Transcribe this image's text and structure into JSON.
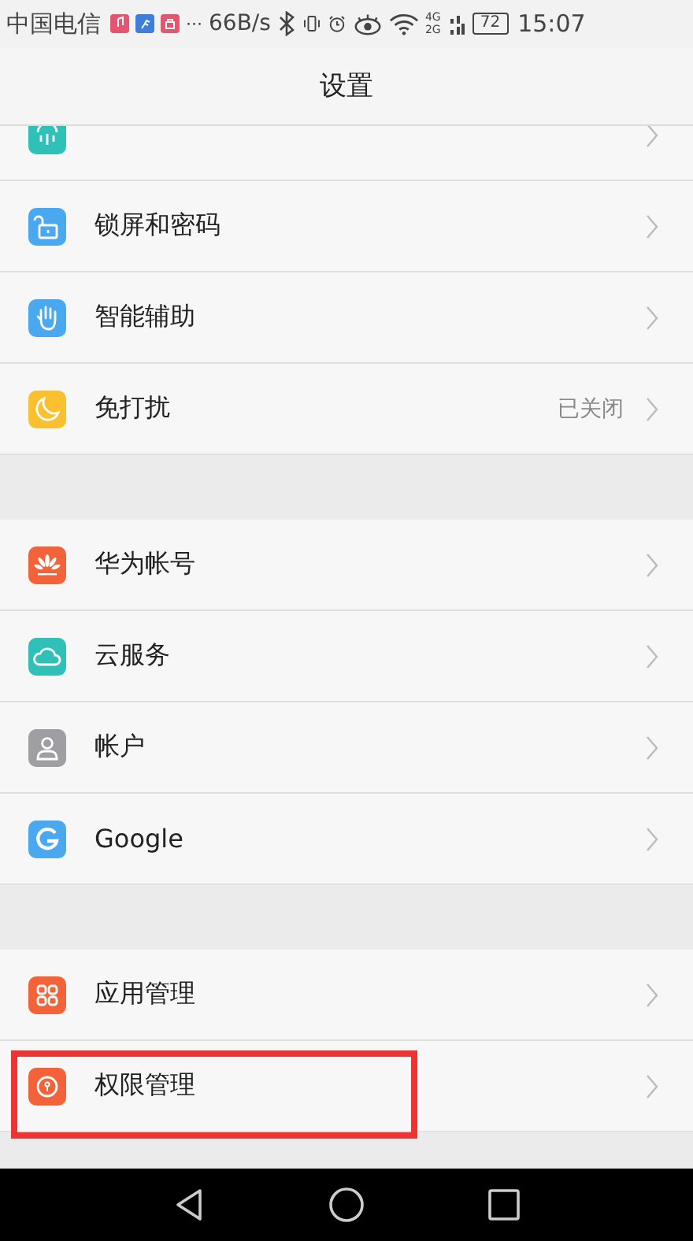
{
  "status_bar": {
    "carrier": "中国电信",
    "more": "···",
    "speed": "66B/s",
    "network_top": "4G",
    "network_bottom": "2G",
    "battery": "72",
    "time": "15:07"
  },
  "title": "设置",
  "groups": [
    {
      "items": [
        {
          "partial": true,
          "color": "#2fc1b8"
        },
        {
          "label": "锁屏和密码",
          "color": "#4aa8f0"
        },
        {
          "label": "智能辅助",
          "color": "#4aa8f0"
        },
        {
          "label": "免打扰",
          "value": "已关闭",
          "color": "#fbc02d"
        }
      ]
    },
    {
      "items": [
        {
          "label": "华为帐号",
          "color": "#f4623a"
        },
        {
          "label": "云服务",
          "color": "#2fc1b8"
        },
        {
          "label": "帐户",
          "color": "#9e9ea3"
        },
        {
          "label": "Google",
          "color": "#4aa8f0"
        }
      ]
    },
    {
      "items": [
        {
          "label": "应用管理",
          "color": "#f4623a"
        },
        {
          "label": "权限管理",
          "color": "#f4623a",
          "highlighted": true
        }
      ]
    }
  ]
}
